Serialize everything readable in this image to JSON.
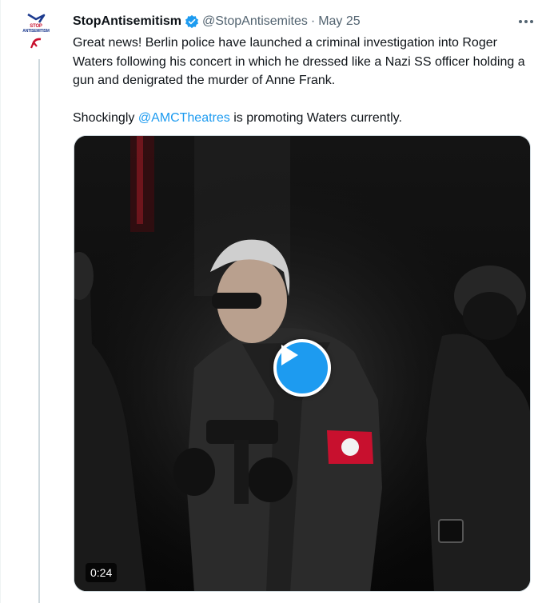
{
  "tweet": {
    "display_name": "StopAntisemitism",
    "handle": "@StopAntisemites",
    "separator": "·",
    "date": "May 25",
    "avatar": {
      "logo_line1": "STOP",
      "logo_line2": "ANTISEMITISM",
      "icon": "stopantisemitism-logo"
    },
    "verified_icon": "verified-badge-icon",
    "more_icon": "more-options-icon",
    "text": {
      "paragraph1": "Great news! Berlin police have launched a criminal investigation into Roger Waters following his concert in which he dressed like a Nazi SS officer holding a gun and denigrated the murder of Anne Frank.",
      "paragraph2_before": "Shockingly ",
      "mention": "@AMCTheatres",
      "paragraph2_after": " is promoting Waters currently."
    },
    "media": {
      "type": "video",
      "play_icon": "play-icon",
      "duration": "0:24"
    }
  },
  "colors": {
    "accent": "#1d9bf0",
    "text": "#0f1419",
    "secondary": "#536471",
    "border": "#cfd9de",
    "armband_red": "#c8102e"
  }
}
